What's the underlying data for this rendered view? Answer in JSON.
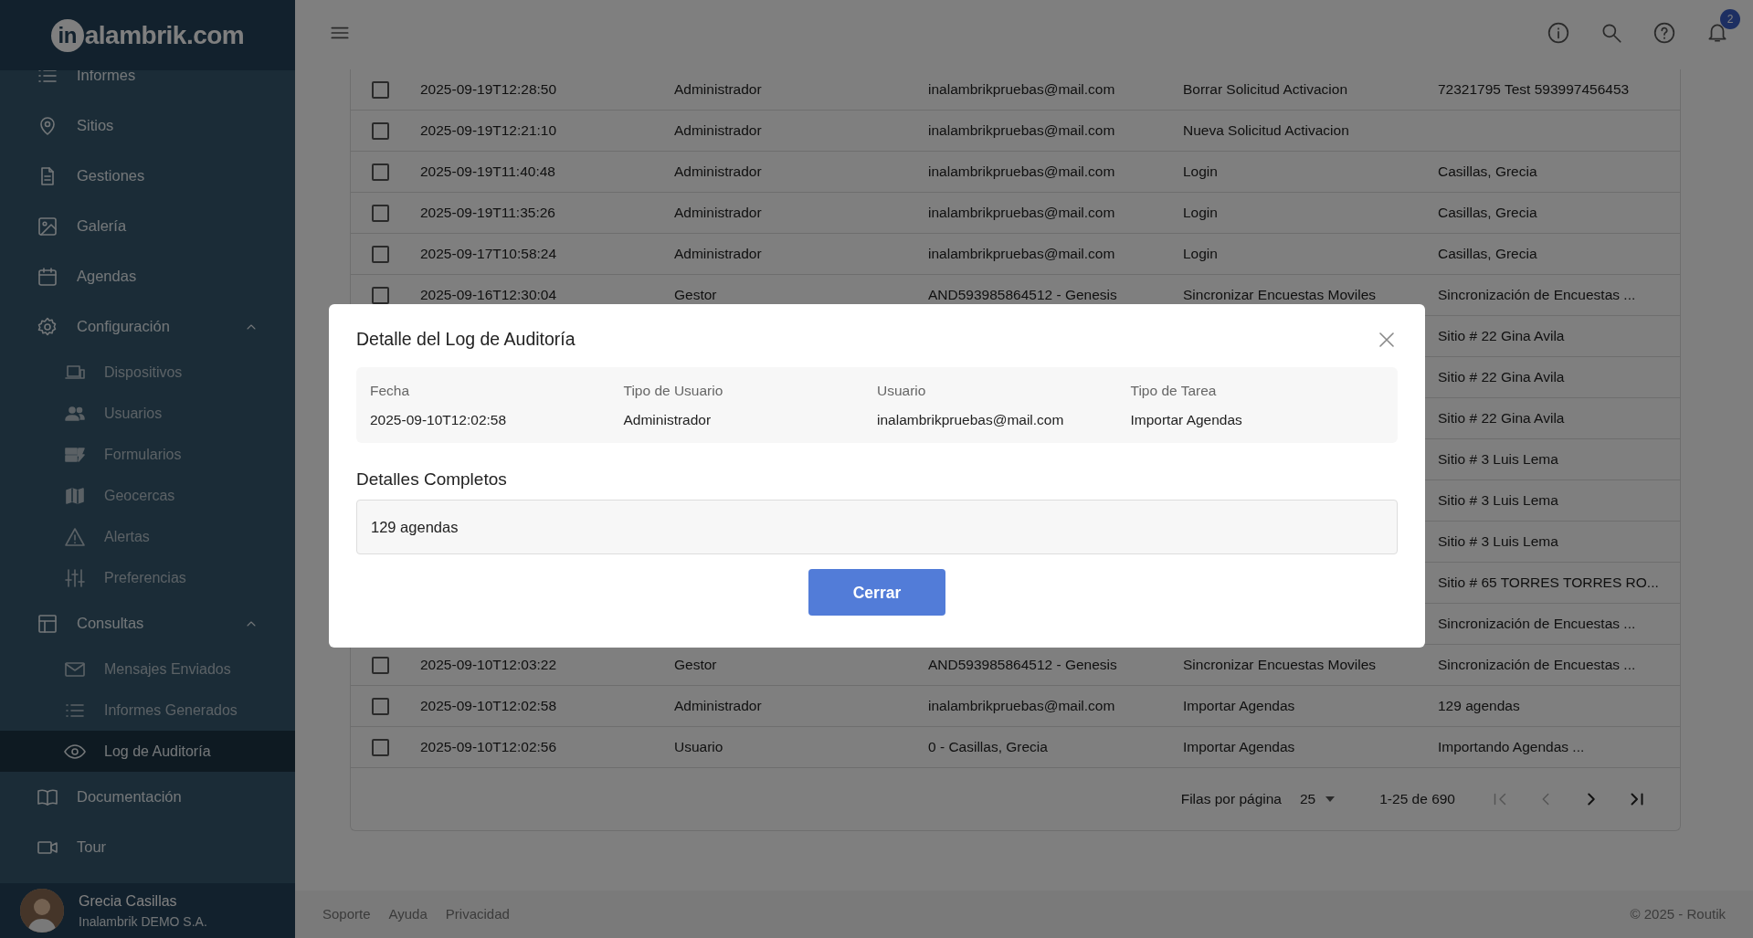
{
  "logo": {
    "mark": "in",
    "text": "alambrik.com"
  },
  "sidebar": {
    "items": [
      {
        "label": "Informes",
        "selected": false
      },
      {
        "label": "Sitios",
        "selected": false
      },
      {
        "label": "Gestiones",
        "selected": false
      },
      {
        "label": "Galería",
        "selected": false
      },
      {
        "label": "Agendas",
        "selected": false
      },
      {
        "label": "Configuración",
        "selected": false,
        "expanded": true,
        "children": [
          {
            "label": "Dispositivos",
            "selected": false
          },
          {
            "label": "Usuarios",
            "selected": false
          },
          {
            "label": "Formularios",
            "selected": false
          },
          {
            "label": "Geocercas",
            "selected": false
          },
          {
            "label": "Alertas",
            "selected": false
          },
          {
            "label": "Preferencias",
            "selected": false
          }
        ]
      },
      {
        "label": "Consultas",
        "selected": false,
        "expanded": true,
        "children": [
          {
            "label": "Mensajes Enviados",
            "selected": false
          },
          {
            "label": "Informes Generados",
            "selected": false
          },
          {
            "label": "Log de Auditoría",
            "selected": true
          }
        ]
      },
      {
        "label": "Documentación",
        "selected": false
      },
      {
        "label": "Tour",
        "selected": false
      }
    ]
  },
  "user": {
    "name": "Grecia Casillas",
    "company": "Inalambrik DEMO S.A."
  },
  "header": {
    "notification_count": "2"
  },
  "table": {
    "rows": [
      {
        "checked": false,
        "date": "2025-09-19T12:28:50",
        "user_type": "Administrador",
        "user": "inalambrikpruebas@mail.com",
        "task": "Borrar Solicitud Activacion",
        "details": "72321795 Test 593997456453"
      },
      {
        "checked": false,
        "date": "2025-09-19T12:21:10",
        "user_type": "Administrador",
        "user": "inalambrikpruebas@mail.com",
        "task": "Nueva Solicitud Activacion"
      },
      {
        "checked": false,
        "date": "2025-09-19T11:40:48",
        "user_type": "Administrador",
        "user": "inalambrikpruebas@mail.com",
        "task": "Login",
        "details": "Casillas, Grecia"
      },
      {
        "checked": false,
        "date": "2025-09-19T11:35:26",
        "user_type": "Administrador",
        "user": "inalambrikpruebas@mail.com",
        "task": "Login",
        "details": "Casillas, Grecia"
      },
      {
        "checked": false,
        "date": "2025-09-17T10:58:24",
        "user_type": "Administrador",
        "user": "inalambrikpruebas@mail.com",
        "task": "Login",
        "details": "Casillas, Grecia"
      },
      {
        "checked": false,
        "date": "2025-09-16T12:30:04",
        "user_type": "Gestor",
        "user": "AND593985864512 - Genesis",
        "task": "Sincronizar Encuestas Moviles",
        "details": "Sincronización de Encuestas ..."
      },
      {
        "details": "Sitio # 22 Gina Avila"
      },
      {
        "details": "Sitio # 22 Gina Avila"
      },
      {
        "details": "Sitio # 22 Gina Avila"
      },
      {
        "details": "Sitio # 3 Luis Lema"
      },
      {
        "details": "Sitio # 3 Luis Lema"
      },
      {
        "details": "Sitio # 3 Luis Lema"
      },
      {
        "details": "Sitio # 65 TORRES TORRES RO..."
      },
      {
        "details": "Sincronización de Encuestas ..."
      },
      {
        "checked": false,
        "date": "2025-09-10T12:03:22",
        "user_type": "Gestor",
        "user": "AND593985864512 - Genesis",
        "task": "Sincronizar Encuestas Moviles",
        "details": "Sincronización de Encuestas ..."
      },
      {
        "checked": false,
        "date": "2025-09-10T12:02:58",
        "user_type": "Administrador",
        "user": "inalambrikpruebas@mail.com",
        "task": "Importar Agendas",
        "details": "129 agendas"
      },
      {
        "checked": false,
        "date": "2025-09-10T12:02:56",
        "user_type": "Usuario",
        "user": "0 - Casillas, Grecia",
        "task": "Importar Agendas",
        "details": "Importando Agendas ..."
      }
    ],
    "pagination": {
      "rows_per_page_label": "Filas por página",
      "rows_per_page": "25",
      "range": "1-25 de 690",
      "nav_buttons": [
        {
          "disabled": true
        },
        {
          "disabled": true
        },
        {
          "disabled": false
        },
        {
          "disabled": false
        }
      ]
    }
  },
  "modal": {
    "title": "Detalle del Log de Auditoría",
    "fields": [
      {
        "label": "Fecha",
        "value": "2025-09-10T12:02:58"
      },
      {
        "label": "Tipo de Usuario",
        "value": "Administrador"
      },
      {
        "label": "Usuario",
        "value": "inalambrikpruebas@mail.com"
      },
      {
        "label": "Tipo de Tarea",
        "value": "Importar Agendas"
      }
    ],
    "details_label": "Detalles Completos",
    "details": "129 agendas",
    "close_button": "Cerrar"
  },
  "footer": {
    "links": [
      "Soporte",
      "Ayuda",
      "Privacidad"
    ],
    "copyright": "© 2025 - Routik"
  }
}
